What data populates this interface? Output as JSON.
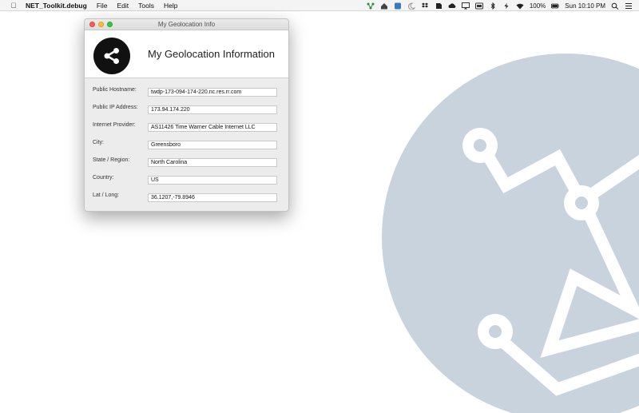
{
  "menubar": {
    "app_name": "NET_Toolkit.debug",
    "menus": [
      "File",
      "Edit",
      "Tools",
      "Help"
    ],
    "battery": "100%",
    "clock": "Sun 10:10 PM",
    "icons": [
      "network-icon",
      "home-icon",
      "app-icon",
      "moon-icon",
      "dropbox-icon",
      "evernote-icon",
      "cloud-icon",
      "airplay-icon",
      "display-icon",
      "bluetooth-icon",
      "bolt-icon",
      "wifi-icon",
      "battery-icon",
      "spotlight-icon",
      "notification-center-icon"
    ]
  },
  "window": {
    "title": "My Geolocation Info",
    "header_title": "My Geolocation Information",
    "header_icon": "share-icon"
  },
  "fields": [
    {
      "label": "Public Hostname:",
      "value": "twdp-173-094-174-220.nc.res.rr.com"
    },
    {
      "label": "Public IP Address:",
      "value": "173.94.174.220"
    },
    {
      "label": "Internet Provider:",
      "value": "AS11426 Time Warner Cable Internet LLC"
    },
    {
      "label": "City:",
      "value": "Greensboro"
    },
    {
      "label": "State / Region:",
      "value": "North Carolina"
    },
    {
      "label": "Country:",
      "value": "US"
    },
    {
      "label": "Lat / Long:",
      "value": "36.1207,-79.8946"
    }
  ],
  "colors": {
    "background_art": "#c9d3de",
    "window_bg": "#ececec",
    "share_circle": "#111111"
  }
}
